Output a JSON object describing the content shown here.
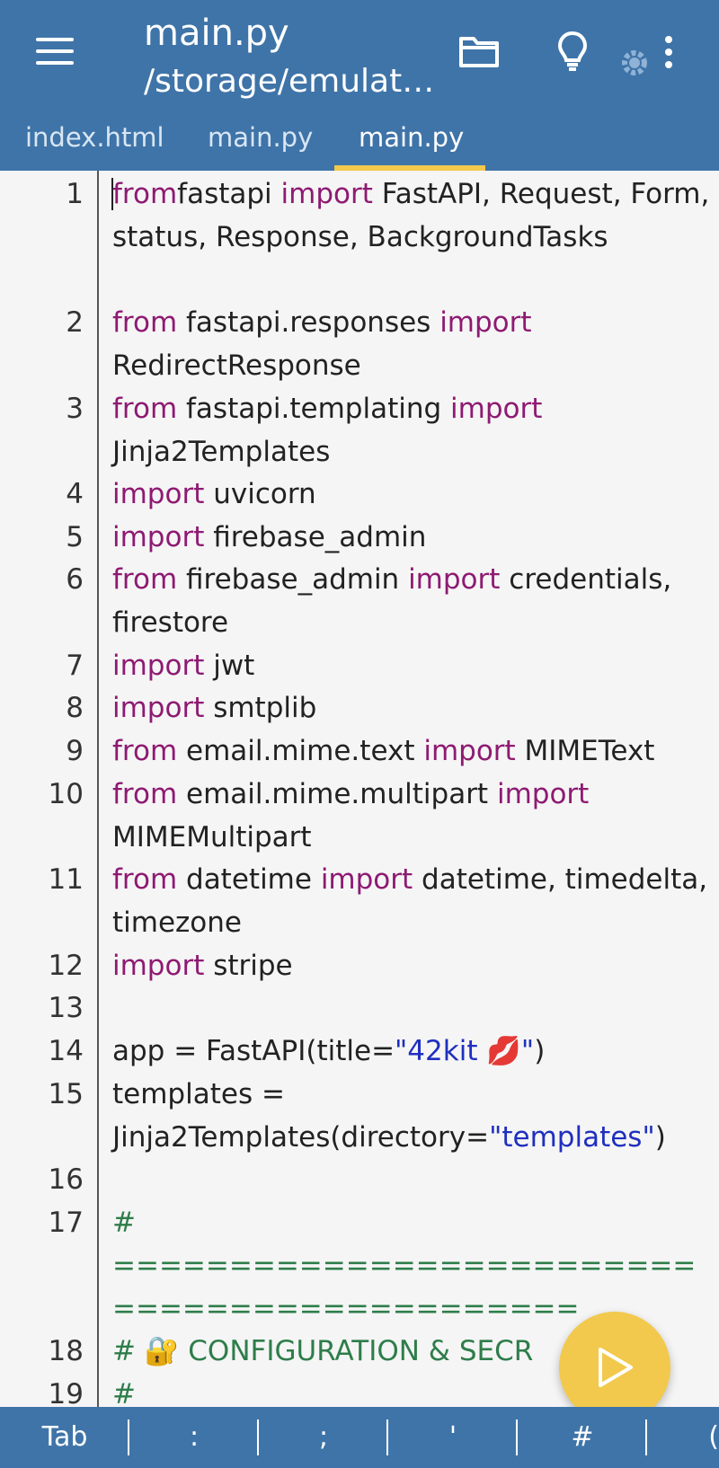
{
  "header": {
    "title": "main.py",
    "subtitle": "/storage/emulat…",
    "icons": [
      "menu-icon",
      "folder-icon",
      "lightbulb-icon",
      "gear-icon",
      "more-vert-icon"
    ]
  },
  "tabs": [
    {
      "label": "index.html",
      "active": false
    },
    {
      "label": "main.py",
      "active": false
    },
    {
      "label": "main.py",
      "active": true
    }
  ],
  "editor": {
    "lines": [
      {
        "num": "1",
        "segments": [
          [
            "kw",
            "from"
          ],
          [
            "",
            "fastapi "
          ],
          [
            "kw",
            "import"
          ],
          [
            "",
            " FastAPI, Request, Form, status, Response, BackgroundTasks"
          ]
        ]
      },
      {
        "num": "2",
        "segments": [
          [
            "kw",
            "from"
          ],
          [
            "",
            " fastapi.responses "
          ],
          [
            "kw",
            "import"
          ],
          [
            "",
            " RedirectResponse"
          ]
        ]
      },
      {
        "num": "3",
        "segments": [
          [
            "kw",
            "from"
          ],
          [
            "",
            " fastapi.templating "
          ],
          [
            "kw",
            "import"
          ],
          [
            "",
            " Jinja2Templates"
          ]
        ]
      },
      {
        "num": "4",
        "segments": [
          [
            "kw",
            "import"
          ],
          [
            "",
            " uvicorn"
          ]
        ]
      },
      {
        "num": "5",
        "segments": [
          [
            "kw",
            "import"
          ],
          [
            "",
            " firebase_admin"
          ]
        ]
      },
      {
        "num": "6",
        "segments": [
          [
            "kw",
            "from"
          ],
          [
            "",
            " firebase_admin "
          ],
          [
            "kw",
            "import"
          ],
          [
            "",
            " credentials, firestore"
          ]
        ]
      },
      {
        "num": "7",
        "segments": [
          [
            "kw",
            "import"
          ],
          [
            "",
            " jwt"
          ]
        ]
      },
      {
        "num": "8",
        "segments": [
          [
            "kw",
            "import"
          ],
          [
            "",
            " smtplib"
          ]
        ]
      },
      {
        "num": "9",
        "segments": [
          [
            "kw",
            "from"
          ],
          [
            "",
            " email.mime.text "
          ],
          [
            "kw",
            "import"
          ],
          [
            "",
            " MIMEText"
          ]
        ]
      },
      {
        "num": "10",
        "segments": [
          [
            "kw",
            "from"
          ],
          [
            "",
            " email.mime.multipart "
          ],
          [
            "kw",
            "import"
          ],
          [
            "",
            " MIMEMultipart"
          ]
        ]
      },
      {
        "num": "11",
        "segments": [
          [
            "kw",
            "from"
          ],
          [
            "",
            " datetime "
          ],
          [
            "kw",
            "import"
          ],
          [
            "",
            " datetime, timedelta, timezone"
          ]
        ]
      },
      {
        "num": "12",
        "segments": [
          [
            "kw",
            "import"
          ],
          [
            "",
            " stripe"
          ]
        ]
      },
      {
        "num": "13",
        "segments": []
      },
      {
        "num": "14",
        "segments": [
          [
            "",
            "app = FastAPI(title="
          ],
          [
            "str",
            "\"42kit 💋\""
          ],
          [
            "",
            ")"
          ]
        ]
      },
      {
        "num": "15",
        "segments": [
          [
            "",
            "templates = Jinja2Templates(directory="
          ],
          [
            "str",
            "\"templates\""
          ],
          [
            "",
            ")"
          ]
        ]
      },
      {
        "num": "16",
        "segments": []
      },
      {
        "num": "17",
        "segments": [
          [
            "cm",
            "# ============================================="
          ]
        ]
      },
      {
        "num": "18",
        "segments": [
          [
            "cm",
            "# 🔐 CONFIGURATION & SECR"
          ]
        ]
      },
      {
        "num": "19",
        "segments": [
          [
            "cm",
            "#"
          ]
        ]
      }
    ]
  },
  "keybar": {
    "keys": [
      "Tab",
      ":",
      ";",
      "'",
      "#",
      "("
    ]
  },
  "colors": {
    "accent": "#3f74a8",
    "tab_indicator": "#f2c94c",
    "keyword": "#8e1a72",
    "string": "#1f2fbf",
    "comment": "#2e7d4a",
    "fab": "#f2c94c"
  }
}
